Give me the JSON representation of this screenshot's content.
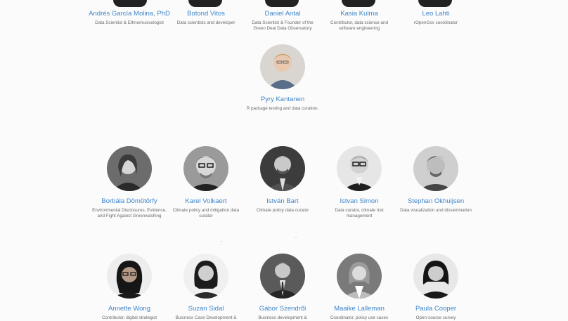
{
  "team": {
    "row1": [
      {
        "name": "Andrés García Molina, PhD",
        "role": "Data Scientist & Ethnomusicologist"
      },
      {
        "name": "Botond Vitos",
        "role": "Data scientists and developer"
      },
      {
        "name": "Daniel Antal",
        "role": "Data Scientist & Founder of the Green Deal Data Observatory"
      },
      {
        "name": "Kasia Kulma",
        "role": "Contributor, data science and software engineering"
      },
      {
        "name": "Leo Lahti",
        "role": "rOpenGov coordinator"
      }
    ],
    "row2": [
      {
        "name": "Pyry Kantanen",
        "role": "R package testing and data curation."
      }
    ],
    "row3": [
      {
        "name": "Borbála Dömötörfy",
        "role": "Environmental Disclosures, Evidence, and Fight Against Greenwashing"
      },
      {
        "name": "Karel Volkaert",
        "role": "Climate policy and mitigation data curator"
      },
      {
        "name": "István Bart",
        "role": "Climate policy data curator"
      },
      {
        "name": "Istvan Simon",
        "role": "Data curator, climate risk management"
      },
      {
        "name": "Stephan Okhuijsen",
        "role": "Data visualization and dissemination"
      }
    ],
    "row4": [
      {
        "name": "Annette Wong",
        "role": "Contributor, digital strategist"
      },
      {
        "name": "Suzan Sidal",
        "role": "Business Case Development &"
      },
      {
        "name": "Gábor Szendrői",
        "role": "Business development &"
      },
      {
        "name": "Maaike Lalleman",
        "role": "Coordinator, policy use cases"
      },
      {
        "name": "Paula Cooper",
        "role": "Open-source survey"
      }
    ]
  },
  "colors": {
    "name_link": "#3f86c9",
    "role_text": "#6b6b6b",
    "background": "#fbfbfb"
  }
}
